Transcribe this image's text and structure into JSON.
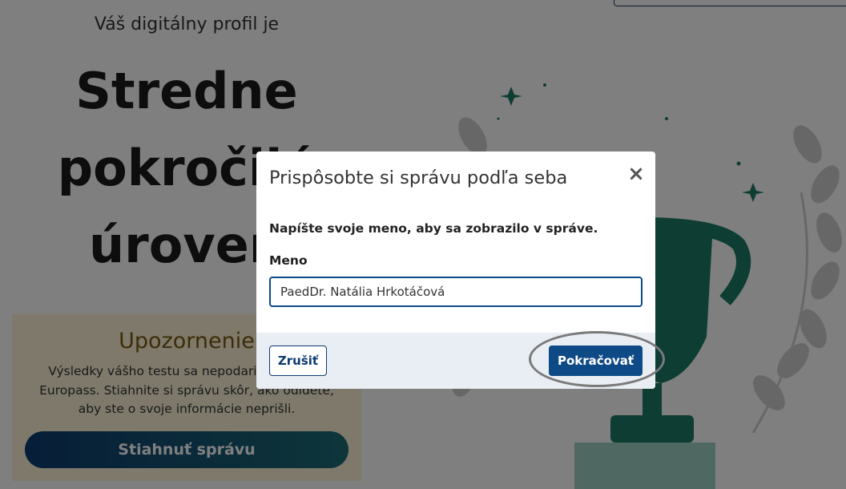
{
  "background": {
    "profile_intro": "Váš digitálny profil je",
    "profile_level_line1": "Stredne",
    "profile_level_line2": "pokročilá",
    "profile_level_line3": "úroveň",
    "notice": {
      "title": "Upozornenie",
      "text": "Výsledky vášho testu sa nepodarilo uložiť do Europass. Stiahnite si správu skôr, ako odídete, aby ste o svoje informácie neprišli.",
      "button_label": "Stiahnuť správu"
    }
  },
  "modal": {
    "title": "Prispôsobte si správu podľa seba",
    "close_icon": "×",
    "instruction": "Napíšte svoje meno, aby sa zobrazilo v správe.",
    "name_label": "Meno",
    "name_value": "PaedDr. Natália Hrkotáčová",
    "cancel_label": "Zrušiť",
    "continue_label": "Pokračovať"
  },
  "colors": {
    "primary": "#0e4a85",
    "trophy": "#1a7a66",
    "notice_bg": "#fcf3d6"
  }
}
